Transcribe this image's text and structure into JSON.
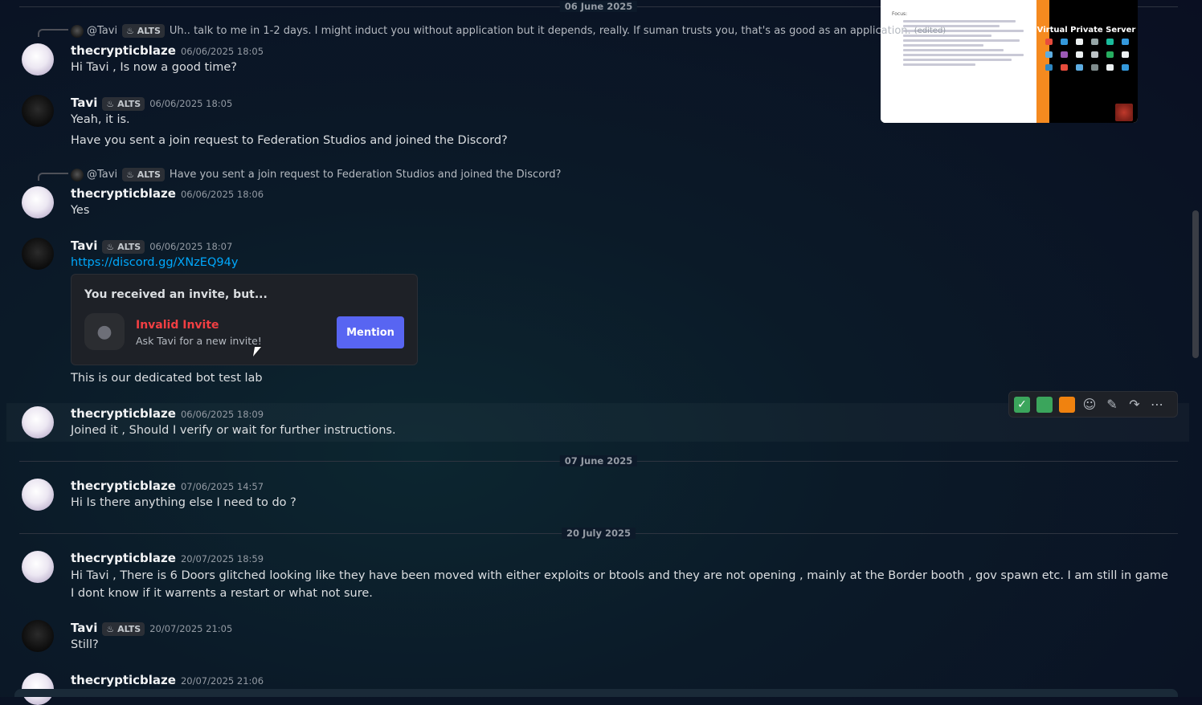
{
  "dividers": {
    "d1": "06 June 2025",
    "d2": "07 June 2025",
    "d3": "20 July 2025"
  },
  "preview": {
    "title": "Virtual Private Server",
    "focus_label": "Focus:"
  },
  "users": {
    "blaze": "thecrypticblaze",
    "tavi": "Tavi",
    "tavi_tag": "ALTS",
    "mention": "@Tavi"
  },
  "messages": {
    "reply1": "Uh.. talk to me in 1-2 days. I might induct you without application but it depends, really. If suman trusts you, that's as good as an application.",
    "reply1_edited": "(edited)",
    "m1_ts": "06/06/2025 18:05",
    "m1_text": "Hi Tavi , Is now a good time?",
    "m2_ts": "06/06/2025 18:05",
    "m2_text1": "Yeah, it is.",
    "m2_text2": "Have you sent a join request to Federation Studios and joined the Discord?",
    "reply2": "Have you sent a join request to Federation Studios and joined the Discord?",
    "m3_ts": "06/06/2025 18:06",
    "m3_text": "Yes",
    "m4_ts": "06/06/2025 18:07",
    "m4_link": "https://discord.gg/XNzEQ94y",
    "m4_text2": "This is our dedicated bot test lab",
    "m5_ts": "06/06/2025 18:09",
    "m5_text": "Joined it , Should I verify or wait for further instructions.",
    "m6_ts": "07/06/2025 14:57",
    "m6_text": "Hi Is there anything else I need to do ?",
    "m7_ts": "20/07/2025 18:59",
    "m7_text": "Hi Tavi , There is 6 Doors glitched looking like they have been moved with either exploits or btools and they are not opening , mainly at the Border booth , gov spawn etc. I am still in game I dont know if it warrents a restart or what not sure.",
    "m8_ts": "20/07/2025 21:05",
    "m8_text": "Still?",
    "m9_ts": "20/07/2025 21:06"
  },
  "invite": {
    "title": "You received an invite, but...",
    "error": "Invalid Invite",
    "sub": "Ask Tavi for a new invite!",
    "button": "Mention"
  },
  "toolbar": {
    "icons": [
      "check-reaction",
      "green-square-reaction",
      "orange-square-reaction",
      "add-reaction",
      "edit",
      "forward",
      "more"
    ]
  },
  "colors": {
    "accent": "#5865f2",
    "link": "#00a8fc",
    "error": "#f23f43"
  }
}
